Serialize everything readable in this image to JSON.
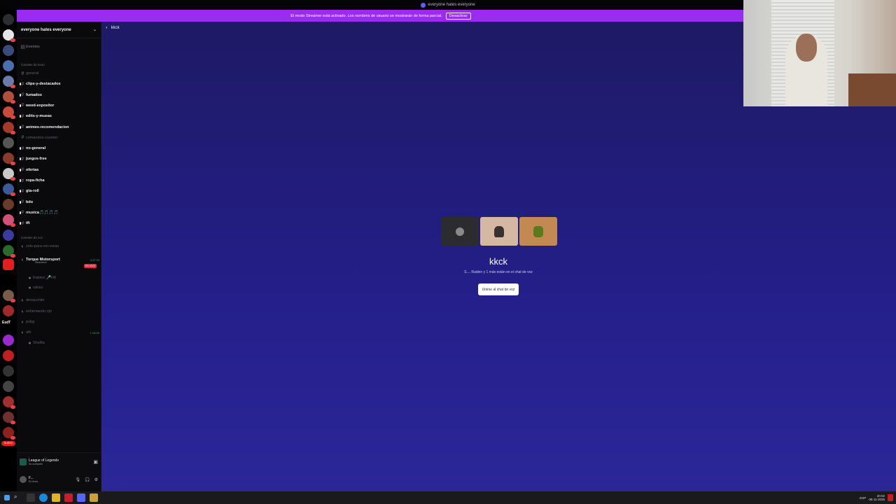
{
  "window": {
    "title": "everyone hates everyone"
  },
  "banner": {
    "text": "El modo Streamer está activado. Los nombres de usuario se mostrarán de forma parcial.",
    "button": "Desactivar"
  },
  "guild": {
    "name": "everyone hates everyone"
  },
  "events_label": "Eventos",
  "text_category": "Canales de texto",
  "text_channels": [
    {
      "name": "general",
      "state": "mute"
    },
    {
      "name": "clips-y-destacados",
      "state": "hl"
    },
    {
      "name": "fumados",
      "state": "hl"
    },
    {
      "name": "weed-expositor",
      "state": "hl"
    },
    {
      "name": "edits-y-mueas",
      "state": "hl"
    },
    {
      "name": "animes-recomendacion",
      "state": "hl"
    },
    {
      "name": "comandos-counter",
      "state": "mute"
    },
    {
      "name": "no-general",
      "state": "hl"
    },
    {
      "name": "juegos-free",
      "state": "hl"
    },
    {
      "name": "ofertas",
      "state": "hl"
    },
    {
      "name": "ropa-ficha",
      "state": "hl"
    },
    {
      "name": "gta-roll",
      "state": "hl"
    },
    {
      "name": "bdo",
      "state": "hl"
    },
    {
      "name": "musica🎵🎵🎵🎵",
      "state": "hl"
    },
    {
      "name": "tft",
      "state": "hl"
    }
  ],
  "voice_category": "Canales de voz",
  "voice_channels": [
    {
      "name": "solo-para-ver-ewas"
    },
    {
      "name": "Torque Motorsport",
      "sub": "Steamtech",
      "time": "4:27:33",
      "live": "EN VIVO"
    },
    {
      "name": "Raiden 🎤HK",
      "indent": true
    },
    {
      "name": "rakiss",
      "indent": true
    },
    {
      "name": "desayunler"
    },
    {
      "name": "exhimiando ojo"
    },
    {
      "name": "pubg"
    },
    {
      "name": "afk",
      "time": "1:18:09"
    },
    {
      "name": "Shellta",
      "indent": true
    }
  ],
  "activity": {
    "game": "League of Legends",
    "status": "No compartir"
  },
  "user": {
    "name": "F...",
    "status": "En línea"
  },
  "main": {
    "channel_name": "kkck",
    "title": "kkck",
    "subtitle": "S..., Raiden y 1 más están en el chat de voz",
    "join_button": "Unirse al chat de voz"
  },
  "server_badges": [
    "NUEVO",
    "EsdT"
  ],
  "taskbar": {
    "time": "20:02",
    "date": "08-11-2025",
    "lang": "ESP"
  },
  "colors": {
    "banner": "#9b2bf0",
    "main_bg": "#241f8a",
    "live": "#e0283a",
    "join_bg": "#ffffff"
  }
}
